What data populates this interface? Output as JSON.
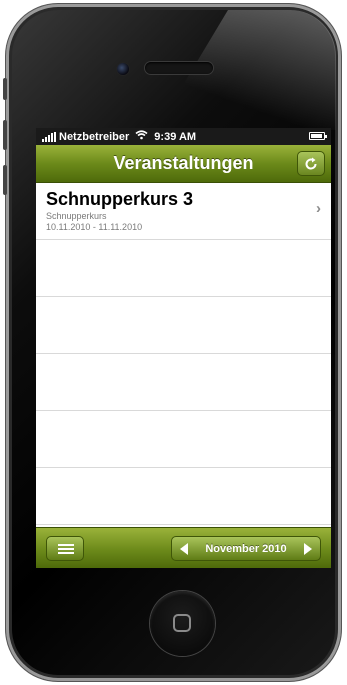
{
  "status_bar": {
    "carrier": "Netzbetreiber",
    "time": "9:39 AM",
    "battery_level": 0.9
  },
  "nav_bar": {
    "title": "Veranstaltungen",
    "refresh_icon": "refresh-icon",
    "accent_color": "#6c8a1a"
  },
  "events": [
    {
      "title": "Schnupperkurs 3",
      "subtitle": "Schnupperkurs",
      "date_range": "10.11.2010 - 11.11.2010"
    }
  ],
  "toolbar": {
    "menu_icon": "menu-icon",
    "prev_icon": "arrow-left-icon",
    "next_icon": "arrow-right-icon",
    "month_label": "November 2010"
  }
}
